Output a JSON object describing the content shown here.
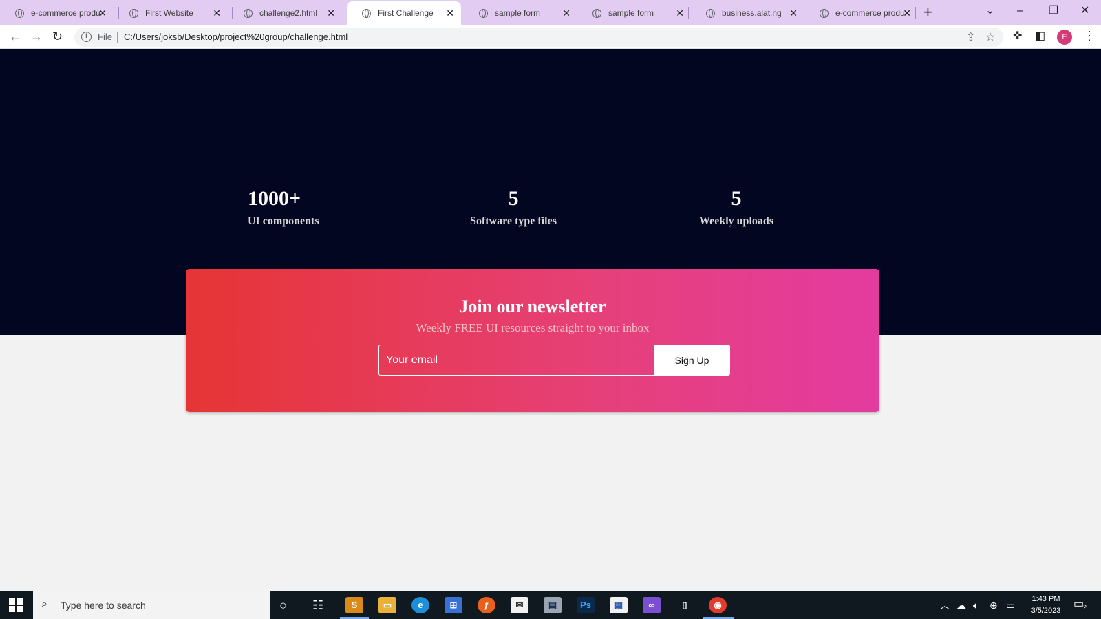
{
  "browser": {
    "tabs": [
      {
        "title": "e-commerce produ",
        "active": false
      },
      {
        "title": "First Website",
        "active": false
      },
      {
        "title": "challenge2.html",
        "active": false
      },
      {
        "title": "First Challenge",
        "active": true
      },
      {
        "title": "sample form",
        "active": false
      },
      {
        "title": "sample form",
        "active": false
      },
      {
        "title": "business.alat.ng",
        "active": false
      },
      {
        "title": "e-commerce produ",
        "active": false
      }
    ],
    "address": {
      "scheme": "File",
      "url": "C:/Users/joksb/Desktop/project%20group/challenge.html"
    },
    "profile_initial": "E"
  },
  "page": {
    "stats": [
      {
        "value": "1000+",
        "label": "UI components"
      },
      {
        "value": "5",
        "label": "Software type files"
      },
      {
        "value": "5",
        "label": "Weekly uploads"
      }
    ],
    "newsletter": {
      "title": "Join our newsletter",
      "subtitle": "Weekly FREE UI resources straight to your inbox",
      "email_placeholder": "Your email",
      "button_label": "Sign Up"
    }
  },
  "taskbar": {
    "search_placeholder": "Type here to search",
    "clock_time": "1:43 PM",
    "clock_date": "3/5/2023",
    "notification_count": "2"
  },
  "colors": {
    "hero_bg": "#020621",
    "newsletter_gradient_start": "#e63535",
    "newsletter_gradient_end": "#e43ba0",
    "tabstrip_bg": "#e3ccf1"
  }
}
